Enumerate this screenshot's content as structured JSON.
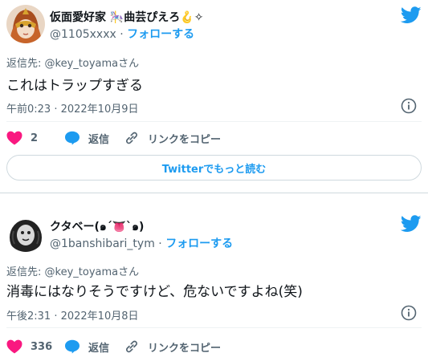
{
  "colors": {
    "twitter_blue": "#1d9bf0",
    "like_pink": "#f91880",
    "secondary_text": "#536471",
    "border": "#cfd9de"
  },
  "tweets": [
    {
      "display_name": "仮面愛好家 🎠曲芸ぴえろ🪝✧",
      "handle": "@1105xxxx",
      "separator": "·",
      "follow_label": "フォローする",
      "reply_to": "返信先: @key_toyamaさん",
      "text": "これはトラップすぎる",
      "timestamp": "午前0:23 · 2022年10月9日",
      "like_count": "2",
      "reply_label": "返信",
      "copy_link_label": "リンクをコピー",
      "read_more_label": "Twitterでもっと読む",
      "icons": [
        "twitter-logo-icon",
        "info-icon",
        "heart-icon",
        "reply-bubble-icon",
        "link-icon"
      ]
    },
    {
      "display_name": "クタベー(๑´👅`๑)",
      "handle": "@1banshibari_tym",
      "separator": "·",
      "follow_label": "フォローする",
      "reply_to": "返信先: @key_toyamaさん",
      "text": "消毒にはなりそうですけど、危ないですよね(笑)",
      "timestamp": "午後2:31 · 2022年10月8日",
      "like_count": "336",
      "reply_label": "返信",
      "copy_link_label": "リンクをコピー",
      "icons": [
        "twitter-logo-icon",
        "info-icon",
        "heart-icon",
        "reply-bubble-icon",
        "link-icon"
      ]
    }
  ]
}
